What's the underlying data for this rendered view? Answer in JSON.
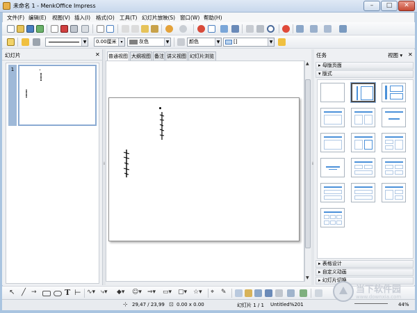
{
  "window": {
    "title": "未命名 1 - MenkOffice Impress",
    "min": "–",
    "max": "□",
    "close": "✕"
  },
  "menu": [
    "文件(F)",
    "编辑(E)",
    "视图(V)",
    "插入(I)",
    "格式(O)",
    "工具(T)",
    "幻灯片放映(S)",
    "窗口(W)",
    "帮助(H)"
  ],
  "toolbar2": {
    "line_width": "0.00厘米",
    "line_color": "灰色",
    "area_style": "颜色",
    "area_fill": "[]"
  },
  "slides_pane": {
    "title": "幻灯片",
    "close": "✕",
    "slide_number": "1"
  },
  "tabs": [
    "普通视图",
    "大纲视图",
    "备注",
    "讲义视图",
    "幻灯片浏览"
  ],
  "tasks_pane": {
    "title": "任务",
    "view": "视图 ▾",
    "close": "✕",
    "sections_top": [
      "母版页面",
      "版式"
    ],
    "sections_bottom": [
      "表格设计",
      "自定义动画",
      "幻灯片切换"
    ]
  },
  "statusbar": {
    "position": "29,47 / 23,99",
    "size": "0.00 x 0.00",
    "slide": "幻灯片 1 / 1",
    "master": "Untitled%201",
    "zoom": "44%"
  },
  "watermark": {
    "brand": "当下软件园",
    "url": "www.downxia.com"
  },
  "colors": {
    "title_bar": "#c8d8ec",
    "selection": "#9fb9d8",
    "accent": "#4a90d9"
  },
  "icons": [
    "new-icon",
    "open-icon",
    "save-icon",
    "pdf-icon",
    "print-icon",
    "spellcheck-icon",
    "cut-icon",
    "copy-icon",
    "paste-icon",
    "undo-icon",
    "redo-icon",
    "chart-icon",
    "table-icon",
    "image-icon",
    "zoom-icon",
    "help-icon"
  ]
}
